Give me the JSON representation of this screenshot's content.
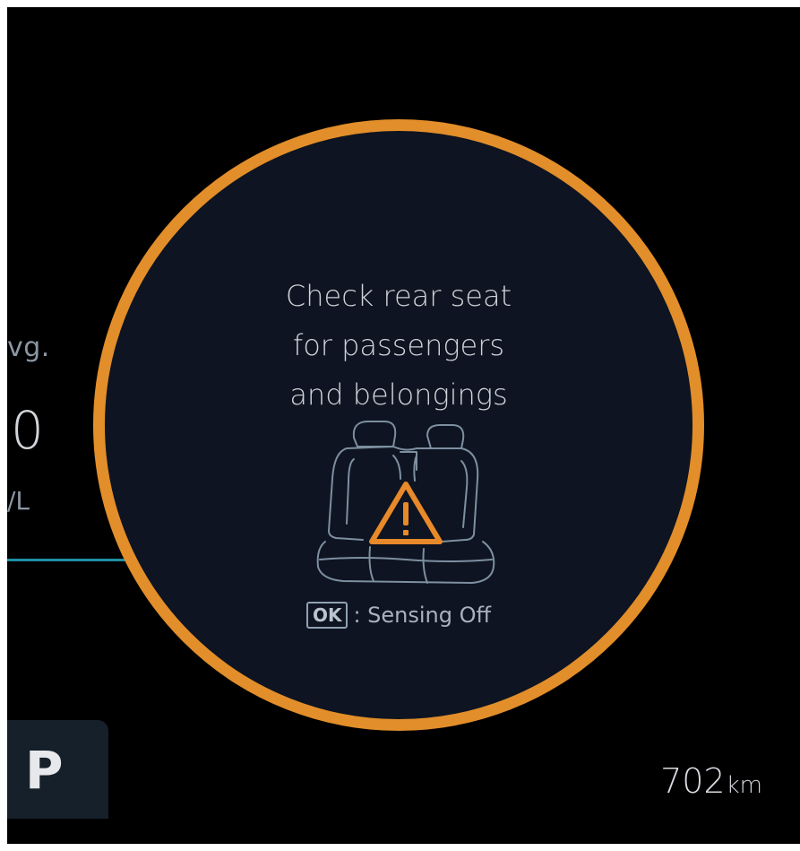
{
  "left_panel": {
    "avg_label": "vg.",
    "value": "0",
    "unit": "/L"
  },
  "gear": {
    "value": "P"
  },
  "range": {
    "value": "702",
    "unit": "km"
  },
  "alert": {
    "lines": [
      "Check rear seat",
      "for passengers",
      "and belongings"
    ],
    "icon": "rear-seat-warning-icon",
    "ok_key": "OK",
    "ok_action": ": Sensing Off"
  },
  "colors": {
    "ring": "#e28e2a",
    "warning": "#e8892a",
    "background": "#000000",
    "circle_fill": "#0e1421",
    "accent_bar": "#1f8fa3"
  }
}
